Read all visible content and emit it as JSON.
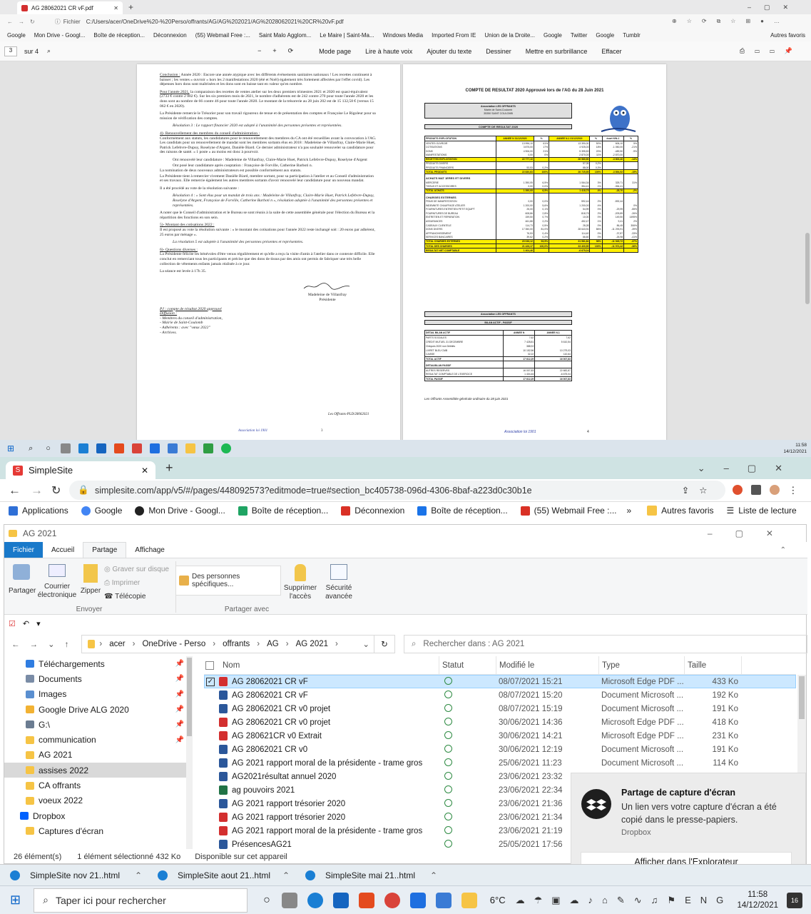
{
  "pdf_viewer": {
    "tab_title": "AG 28062021 CR vF.pdf",
    "address_label": "Fichier",
    "address": "C:/Users/acer/OneDrive%20-%20Perso/offrants/AG/AG%202021/AG%2028062021%20CR%20vF.pdf",
    "favorites": [
      "Google",
      "Mon Drive - Googl...",
      "Boîte de réception...",
      "Déconnexion",
      "(55) Webmail Free :...",
      "Saint Malo Agglom...",
      "Le Maire | Saint-Ma...",
      "Windows Media",
      "Imported From IE",
      "Union de la Droite...",
      "Google",
      "Twitter",
      "Google",
      "Tumblr"
    ],
    "favorites_folder": "Autres favoris",
    "page_current": "3",
    "page_total": "sur 4",
    "tools": [
      "Mode page",
      "Lire à haute voix",
      "Ajouter du texte",
      "Dessiner",
      "Mettre en surbrillance",
      "Effacer"
    ],
    "page3": {
      "conclusion_title": "Conclusion :",
      "conclusion": "Année 2020 : Encore une année atypique avec les différents événements sanitaires nationaux ! Les recettes continuent à baisser ; les ventes « ouvroir » hors les 2 manifestations 2020 (été et Noël) également très fortement affectées par l'effet covid). Les dépenses hors dons sont maîtrisées et les dons sont en baisse tant en valeur qu'en nombre.",
      "p2021_title": "Pour l'année 2021,",
      "p2021": "la comparaison des recettes de ventes atelier sur les deux premiers trimestres 2021 et 2020 est quasi-équivalent (2733 € contre 2 802 €). Sur les six premiers mois de 2021, le nombre d'adhérents est de 242 contre 270 pour toute l'année 2020 et les dons sont au nombre de 66 contre 46 pour toute l'année 2020. Le montant de la trésorerie au 28 juin 202 est de 15 132,58 € (versus 15 062 € en 2020).",
      "president_thanks": "La Présidente remercie le Trésorier pour son travail rigoureux de tenue et de présentation des comptes et Françoise Le Rigoleur pour sa mission de vérification des comptes.",
      "resolution3": "Résolution 3 : Le rapport financier 2020 est adopté à l'unanimité des personnes présentes et représentées.",
      "s4_title": "4)- Renouvellement des membres du conseil d'administration :",
      "s4": "Conformément aux statuts, les candidatures pour le renouvellement des membres du CA ont été recueillies avant la convocation à l'AG. Les candidats pour un renouvellement de mandat sont les membres sortants élus en 2018 : Madeleine de Villanfray, Claire-Marie Huet, Patrick Lefebvre-Dupuy, Roselyne d'Argent, Danièle Biard. Ce dernier administrateur n'a pas souhaité renouveler sa candidature pour des raisons de santé. « 1 poste » au moins est donc à pourvoir.",
      "s4_b1": "Ont renouvelé leur candidature : Madeleine de Villanfray, Claire-Marie Huet, Patrick Lefebvre-Dupuy, Roselyne d'Argent",
      "s4_b2": "Ont posé leur candidature après cooptation : Françoise de Forville, Catherine Barboti n.",
      "s4_after": "La nomination de deux nouveaux administrateurs est possible conformément aux statuts.",
      "s4_thanks": "La Présidente tient à remercier vivement Danièle Biard, membre sortant, pour sa participation à l'atelier et au Conseil d'administration et ses travaux. Elle remercie également les autres membres sortants d'avoir renouvelé leur candidature pour un nouveau mandat.",
      "s4_vote": "Il a été procédé au vote de la résolution suivante :",
      "resolution4": "Résolution 4 : « Sont élus pour un mandat de trois ans : Madeleine de Villanfray, Claire-Marie Huet, Patrick Lefebvre-Dupuy, Roselyne d'Argent, Françoise de Forville, Catherine Barboti n », résolution adoptée à l'unanimité des personnes présentes et représentées.",
      "note": "A noter que le Conseil d'administration et le Bureau se sont réunis à la suite de cette assemblée générale pour l'élection du Bureau et la répartition des fonctions en son sein.",
      "s5_title": "5)- Montant des cotisations 2022 :",
      "s5": "Il est proposé au vote la résolution suivante : « le montant des cotisations pour l'année 2022 reste inchangé soit : 20 euros par adhérent, 25 euros par ménage ».",
      "resolution5": "La résolution 5 est adoptée à l'unanimité des personnes présentes et représentées.",
      "s6_title": "6)- Questions diverses :",
      "s6": "La Présidente félicite les bénévoles d'être venus régulièrement et qu'elle a reçu la visite d'amis à l'atelier dans ce contexte difficile. Elle conclut en remerciant tous les participants et précise que des dons de tissus par des amis ont permis de fabriquer une très belle collection de vêtements enfants jamais réalisée à ce jour.",
      "closing": "La séance est levée à 17h 35.",
      "signer": "Madeleine de Villanfray",
      "signer_role": "Présidente",
      "pj_title": "PJ : compte de résultat 2020 approuvé",
      "diffusion": "Diffusion :",
      "diff_items": [
        "- Membres du conseil d'administration,",
        "- Mairie de Saint-Coulomb",
        "- Adhérents : avec \"vœux 2022\"",
        "- Archives."
      ],
      "ref": "Les Offrants-PLD/28062021",
      "footer_left": "Association loi 1901",
      "page_no": "3"
    },
    "page4": {
      "title": "COMPTE DE RESULTAT 2020 Approuvé lors de l'AG du 28 Juin 2021",
      "org": "Association LES OFFRANTS",
      "org_addr1": "Mairie de Saint-Coulomb",
      "org_addr2": "35350 SAINT COULOMB",
      "section_title": "COMPTE DE RESULTAT 2020",
      "col_headers": [
        "PRODUITS EXPLOITATION",
        "ANNEE N 31/12/2020",
        "%",
        "ANNEE N-1 31/12/2019",
        "%",
        "écart N/N-1",
        "%"
      ],
      "rows": [
        [
          "VENTES OUVROIR",
          "13 996,10",
          "61%",
          "13 390,00",
          "50%",
          "606,10",
          "5%"
        ],
        [
          "COTISATIONS",
          "3 875,00",
          "17%",
          "4 925,00",
          "18%",
          "-1 050,00",
          "-21%"
        ],
        [
          "DONS",
          "4 906,00",
          "21%",
          "5 395,50",
          "20%",
          "-489,50",
          "-9%"
        ],
        [
          "MANIFESTATIONS",
          "0,00",
          "0%",
          "2 870,00",
          "11%",
          "-2 870,00",
          ""
        ],
        [
          "RECETTES EXPLOITATION",
          "22 777,10",
          "",
          "26 580,50",
          "",
          "-3 803,40",
          "-14%"
        ],
        [
          "PRODUITS DIVERS",
          "",
          "",
          "57,05",
          "0,2%",
          "",
          ""
        ],
        [
          "PRODUITS FINANCIERS",
          "53,53",
          "0,2%",
          "88,00",
          "0,3%",
          "",
          ""
        ],
        [
          "TOTAL PRODUITS",
          "22 830,63",
          "100%",
          "26 725,55",
          "100%",
          "-3 894,92",
          "-15%"
        ],
        [
          "ACHATS MAT 1ERES ET DIVERS",
          "",
          "",
          "",
          "",
          "",
          ""
        ],
        [
          "MERCERIE",
          "1 390,05",
          "6,5%",
          "1 064,34",
          "3%",
          "325,71",
          "31%"
        ],
        [
          "TISSUS ET ACCESSOIRES",
          "0,00",
          "0,0%",
          "354,41",
          "1%",
          "-354,41",
          ""
        ],
        [
          "TOTAL ACHATS",
          "1 390,05",
          "6,5%",
          "1 418,75",
          "4%",
          "-28,70",
          "-2%"
        ],
        [
          "CHARGES EXTERNES",
          "",
          "",
          "",
          "",
          "",
          ""
        ],
        [
          "FRAIS DE MANIFESTATION",
          "0,00",
          "0,0%",
          "592,44",
          "2%",
          "-592,44",
          ""
        ],
        [
          "INDEMNITE CHAUFFAGE ATELIER",
          "1 200,00",
          "5,6%",
          "1 200,00",
          "4%",
          "",
          "0%"
        ],
        [
          "FOURNITURES ENTRETIEN PETIT EQUIPT",
          "25,00",
          "0,1%",
          "54,99",
          "0%",
          "-29,99",
          "-55%"
        ],
        [
          "FOURNITURES DE BUREAU",
          "608,86",
          "2,8%",
          "818,75",
          "2%",
          "-209,89",
          "-26%"
        ],
        [
          "ENTRETIEN ET REPARATION",
          "159,50",
          "0,7%",
          "10,00",
          "0%",
          "149,50",
          "1495%"
        ],
        [
          "ASSURANCES",
          "461,88",
          "2,2%",
          "452,47",
          "1%",
          "9,41",
          "2%"
        ],
        [
          "CADEAUX CLIENTELE",
          "114,73",
          "0,5%",
          "28,28",
          "0%",
          "86,45",
          "306%"
        ],
        [
          "DONS DIVERS",
          "17 350,00",
          "81,0%",
          "28 643,91",
          "86%",
          "-11 293,91",
          "-39%"
        ],
        [
          "AFFRANCHISSEMENT",
          "76,53",
          "0,4%",
          "114,40",
          "0%",
          "-37,87",
          "-33%"
        ],
        [
          "SERVICES BANCAIRES",
          "39,62",
          "0,2%",
          "66,60",
          "0%",
          "-26,98",
          "-41%"
        ],
        [
          "TOTAL CHARGES EXTERNES",
          "20 036,12",
          "93,5%",
          "31 981,84",
          "96%",
          "-11 945,72",
          "-37%"
        ],
        [
          "TOTAL DES CHARGES",
          "21 426,17",
          "100,0%",
          "33 400,59",
          "100%",
          "-11 974,42",
          "-36%"
        ],
        [
          "RESULTAT NET COMPTABLE",
          "1 404,46",
          "",
          "-6 675,04",
          "",
          "",
          ""
        ]
      ],
      "bilan_org": "Association LES OFFRANTS",
      "bilan_title": "BILAN ACTIF - PASSIF",
      "bilan_headers": [
        "DETAIL BILAN ACTIF",
        "ANNEE N",
        "ANNEE N-1"
      ],
      "bilan_rows": [
        [
          "PARTS SOCIALES",
          "7,62",
          "7,62"
        ],
        [
          "CREDIT MUTUEL 31 DECEMBRE",
          "7 428,81",
          "5 610,54"
        ],
        [
          "Chèques 2020 non Débités",
          "388,92",
          ""
        ],
        [
          "LIVRET BLEU CMB",
          "10 152,56",
          "10 279,03"
        ],
        [
          "CAISSE",
          "32,22",
          "110,64"
        ],
        [
          "TOTAL ACTIF",
          "17 612,29",
          "16 007,83"
        ]
      ],
      "passif_header": "DETAILBILAN PASSIF",
      "passif_rows": [
        [
          "AUTRES RESERVES",
          "16 007,83",
          "22 682,87"
        ],
        [
          "RESULTAT COMPTABLE DE L'EXERCICE",
          "1 404,46",
          "-6 675,04"
        ],
        [
          "TOTAL PASSIF",
          "17 612,29",
          "16 007,83"
        ]
      ],
      "note": "Les Offrants Assemblée générale ordinaire du 28 juin 2021",
      "footer_left": "Association loi 1901",
      "page_no": "4"
    }
  },
  "taskbar_top": {
    "time": "11:58",
    "date": "14/12/2021"
  },
  "chrome": {
    "tab_title": "SimpleSite",
    "url": "simplesite.com/app/v5/#/pages/448092573?editmode=true#section_bc405738-096d-4306-8baf-a223d0c30b1e",
    "bookmarks": [
      "Applications",
      "Google",
      "Mon Drive - Googl...",
      "Boîte de réception...",
      "Déconnexion",
      "Boîte de réception...",
      "(55) Webmail Free :..."
    ],
    "bm_more": "»",
    "other_favs": "Autres favoris",
    "reading_list": "Liste de lecture"
  },
  "explorer": {
    "title": "AG 2021",
    "ribbon_tabs": [
      "Fichier",
      "Accueil",
      "Partage",
      "Affichage"
    ],
    "ribbon": {
      "share": "Partager",
      "email": "Courrier électronique",
      "zip": "Zipper",
      "burn": "Graver sur disque",
      "print": "Imprimer",
      "fax": "Télécopie",
      "group1": "Envoyer",
      "specific": "Des personnes spécifiques...",
      "group2": "Partager avec",
      "remove": "Supprimer l'accès",
      "security": "Sécurité avancée"
    },
    "breadcrumb": [
      "acer",
      "OneDrive - Perso",
      "offrants",
      "AG",
      "AG 2021"
    ],
    "search_placeholder": "Rechercher dans : AG 2021",
    "sidebar": [
      {
        "label": "Téléchargements",
        "pin": true
      },
      {
        "label": "Documents",
        "pin": true
      },
      {
        "label": "Images",
        "pin": true
      },
      {
        "label": "Google Drive ALG 2020",
        "pin": true
      },
      {
        "label": "G:\\",
        "pin": true
      },
      {
        "label": "communication",
        "pin": true
      },
      {
        "label": "AG 2021",
        "pin": false
      },
      {
        "label": "assises 2022",
        "pin": false
      },
      {
        "label": "CA offrants",
        "pin": false
      },
      {
        "label": "voeux 2022",
        "pin": false
      },
      {
        "label": "Dropbox",
        "pin": false
      },
      {
        "label": "Captures d'écran",
        "pin": false
      }
    ],
    "columns": [
      "Nom",
      "Statut",
      "Modifié le",
      "Type",
      "Taille"
    ],
    "files": [
      {
        "name": "AG 28062021 CR vF",
        "kind": "pdf",
        "date": "08/07/2021 15:21",
        "type": "Microsoft Edge PDF ...",
        "size": "433 Ko"
      },
      {
        "name": "AG 28062021 CR vF",
        "kind": "word",
        "date": "08/07/2021 15:20",
        "type": "Document Microsoft ...",
        "size": "192 Ko"
      },
      {
        "name": "AG 28062021 CR v0 projet",
        "kind": "word",
        "date": "08/07/2021 15:19",
        "type": "Document Microsoft ...",
        "size": "191 Ko"
      },
      {
        "name": "AG 28062021 CR v0 projet",
        "kind": "pdf",
        "date": "30/06/2021 14:36",
        "type": "Microsoft Edge PDF ...",
        "size": "418 Ko"
      },
      {
        "name": "AG 280621CR v0 Extrait",
        "kind": "pdf",
        "date": "30/06/2021 14:21",
        "type": "Microsoft Edge PDF ...",
        "size": "231 Ko"
      },
      {
        "name": "AG 28062021 CR v0",
        "kind": "word",
        "date": "30/06/2021 12:19",
        "type": "Document Microsoft ...",
        "size": "191 Ko"
      },
      {
        "name": "AG 2021 rapport moral de la présidente - trame gros",
        "kind": "word",
        "date": "25/06/2021 11:23",
        "type": "Document Microsoft ...",
        "size": "114 Ko"
      },
      {
        "name": "AG2021résultat annuel 2020",
        "kind": "word",
        "date": "23/06/2021 23:32",
        "type": "",
        "size": ""
      },
      {
        "name": "ag pouvoirs 2021",
        "kind": "excel",
        "date": "23/06/2021 22:34",
        "type": "",
        "size": ""
      },
      {
        "name": "AG 2021 rapport trésorier 2020",
        "kind": "word",
        "date": "23/06/2021 21:36",
        "type": "",
        "size": ""
      },
      {
        "name": "AG 2021 rapport trésorier 2020",
        "kind": "pdf",
        "date": "23/06/2021 21:34",
        "type": "",
        "size": ""
      },
      {
        "name": "AG 2021 rapport moral de la présidente - trame gros",
        "kind": "pdf",
        "date": "23/06/2021 21:19",
        "type": "",
        "size": ""
      },
      {
        "name": "PrésencesAG21",
        "kind": "word",
        "date": "25/05/2021 17:56",
        "type": "",
        "size": ""
      }
    ],
    "status": {
      "count": "26 élément(s)",
      "selected": "1 élément sélectionné  432 Ko",
      "avail": "Disponible sur cet appareil"
    }
  },
  "toast": {
    "title": "Partage de capture d'écran",
    "body": "Un lien vers votre capture d'écran a été copié dans le presse-papiers.",
    "source": "Dropbox",
    "button": "Afficher dans l'Explorateur"
  },
  "taskbar_tabs": [
    "SimpleSite nov 21..html",
    "SimpleSite aout 21..html",
    "SimpleSite mai 21..html"
  ],
  "taskbar": {
    "search": "Taper ici pour rechercher",
    "temp": "6°C",
    "time": "11:58",
    "date": "14/12/2021",
    "notif_count": "16"
  }
}
